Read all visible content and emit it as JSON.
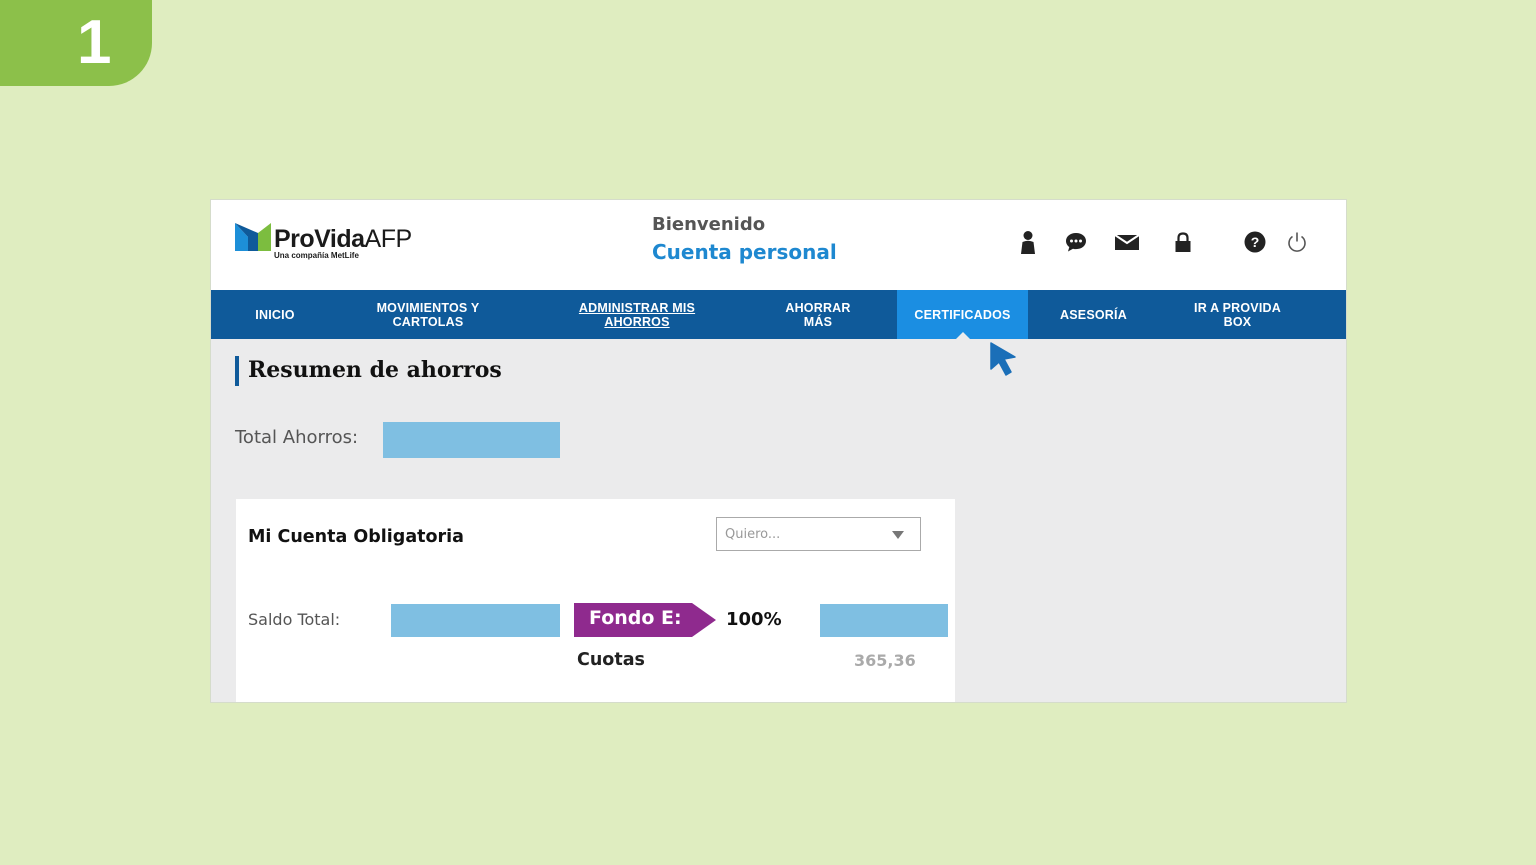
{
  "step": {
    "number": "1"
  },
  "colors": {
    "background": "#dfedc0",
    "badge": "#8cc04a",
    "nav": "#0f5a9a",
    "nav_active": "#1b8ee2",
    "accent_blue": "#1e88d0",
    "fondo": "#8f2a8e",
    "masked_value": "#7fbfe2"
  },
  "header": {
    "brand_bold": "ProVida",
    "brand_suffix": "AFP",
    "tagline": "Una compañía MetLife",
    "welcome": "Bienvenido",
    "account_type": "Cuenta personal",
    "icons": [
      "user-icon",
      "chat-icon",
      "mail-icon",
      "lock-icon",
      "help-icon",
      "power-icon"
    ]
  },
  "nav": {
    "items": [
      {
        "label": "INICIO"
      },
      {
        "label": "MOVIMIENTOS Y\nCARTOLAS"
      },
      {
        "label": "ADMINISTRAR MIS\nAHORROS"
      },
      {
        "label": "AHORRAR\nMÁS"
      },
      {
        "label": "CERTIFICADOS"
      },
      {
        "label": "ASESORÍA"
      },
      {
        "label": "IR A PROVIDA\nBOX"
      }
    ],
    "active": "CERTIFICADOS"
  },
  "main": {
    "title": "Resumen de ahorros",
    "total_label": "Total Ahorros:",
    "card": {
      "title": "Mi Cuenta Obligatoria",
      "select_placeholder": "Quiero...",
      "saldo_label": "Saldo Total:",
      "fondo_label": "Fondo E:",
      "fondo_percent": "100%",
      "cuotas_label": "Cuotas",
      "cuotas_value": "365,36"
    }
  }
}
